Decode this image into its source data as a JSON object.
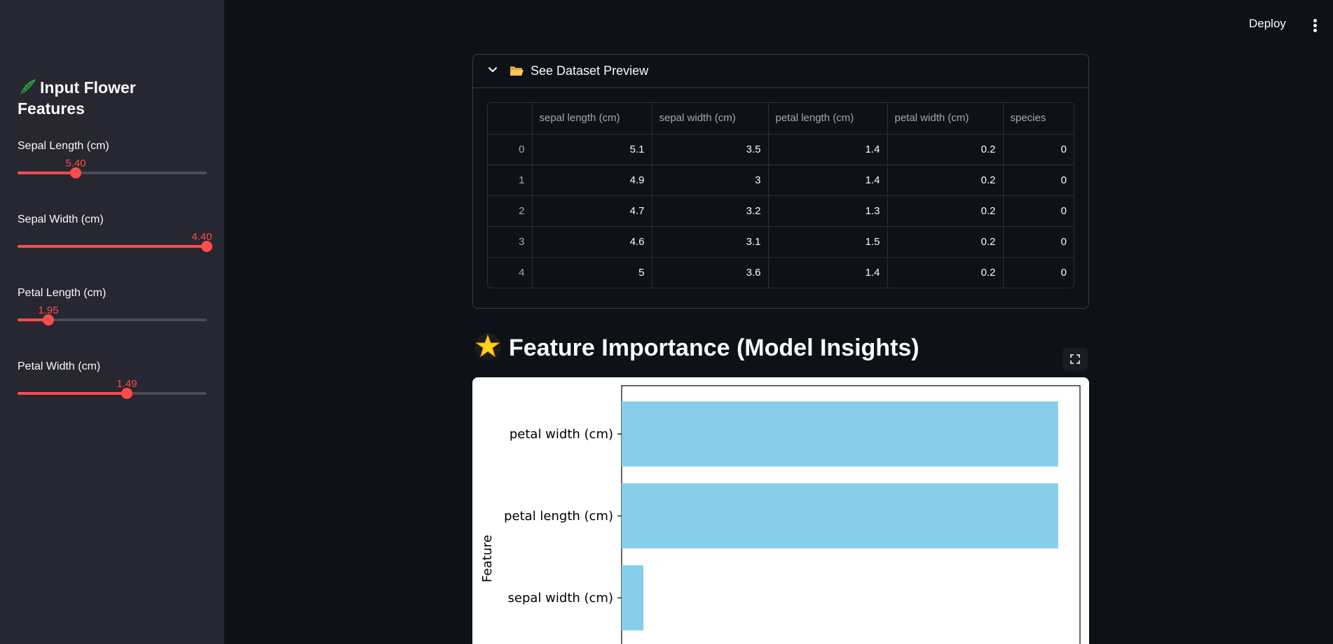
{
  "sidebar": {
    "header": "Input Flower Features",
    "sliders": [
      {
        "label": "Sepal Length (cm)",
        "value": "5.40",
        "fraction": 0.31
      },
      {
        "label": "Sepal Width (cm)",
        "value": "4.40",
        "fraction": 1.0
      },
      {
        "label": "Petal Length (cm)",
        "value": "1.95",
        "fraction": 0.16
      },
      {
        "label": "Petal Width (cm)",
        "value": "1.49",
        "fraction": 0.58
      }
    ]
  },
  "toolbar": {
    "deploy_label": "Deploy",
    "menu_icon": "kebab-menu-icon"
  },
  "expander": {
    "title": "See Dataset Preview",
    "icons": [
      "chevron-down-icon",
      "folder-icon"
    ],
    "table": {
      "columns": [
        "",
        "sepal length (cm)",
        "sepal width (cm)",
        "petal length (cm)",
        "petal width (cm)",
        "species"
      ],
      "rows": [
        [
          "0",
          "5.1",
          "3.5",
          "1.4",
          "0.2",
          "0"
        ],
        [
          "1",
          "4.9",
          "3",
          "1.4",
          "0.2",
          "0"
        ],
        [
          "2",
          "4.7",
          "3.2",
          "1.3",
          "0.2",
          "0"
        ],
        [
          "3",
          "4.6",
          "3.1",
          "1.5",
          "0.2",
          "0"
        ],
        [
          "4",
          "5",
          "3.6",
          "1.4",
          "0.2",
          "0"
        ]
      ]
    }
  },
  "feature_importance": {
    "title": "Feature Importance (Model Insights)",
    "icon": "star-icon",
    "fullscreen_icon": "fullscreen-icon"
  },
  "chart_data": {
    "type": "bar",
    "orientation": "horizontal",
    "categories": [
      "petal width (cm)",
      "petal length (cm)",
      "sepal width (cm)"
    ],
    "values": [
      0.44,
      0.44,
      0.022
    ],
    "ylabel": "Feature",
    "bar_color": "#87ceeb"
  },
  "colors": {
    "accent": "#ff4b4b",
    "background": "#0e1117",
    "sidebar": "#262730"
  }
}
